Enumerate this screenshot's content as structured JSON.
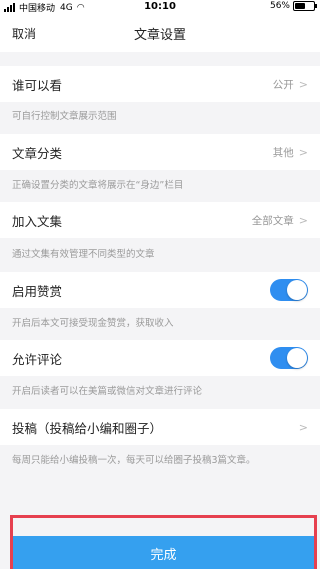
{
  "status_bar": {
    "carrier": "中国移动",
    "network": "4G",
    "time": "10:10",
    "battery": "56%",
    "battery_level": 0.56
  },
  "nav": {
    "cancel_label": "取消",
    "title": "文章设置"
  },
  "settings": [
    {
      "label": "谁可以看",
      "value": "公开",
      "description": "可自行控制文章展示范围"
    },
    {
      "label": "文章分类",
      "value": "其他",
      "description": "正确设置分类的文章将展示在“身边”栏目"
    },
    {
      "label": "加入文集",
      "value": "全部文章",
      "description": "通过文集有效管理不同类型的文章"
    },
    {
      "label": "启用赞赏",
      "toggle_on": true,
      "description": "开启后本文可接受现金赞赏，获取收入"
    },
    {
      "label": "允许评论",
      "toggle_on": true,
      "description": "开启后读者可以在美篇或微信对文章进行评论"
    },
    {
      "label": "投稿（投稿给小编和圈子）",
      "description": "每周只能给小编投稿一次，每天可以给圈子投稿3篇文章。"
    }
  ],
  "footer": {
    "done_label": "完成"
  },
  "colors": {
    "accent": "#2f8ef0",
    "done_button": "#35a0ef",
    "highlight_border": "#e6404f",
    "background": "#f4f4f6"
  },
  "icons": {
    "chevron": "chevron-right-icon",
    "signal": "signal-icon",
    "wifi": "wifi-icon",
    "battery": "battery-icon"
  }
}
